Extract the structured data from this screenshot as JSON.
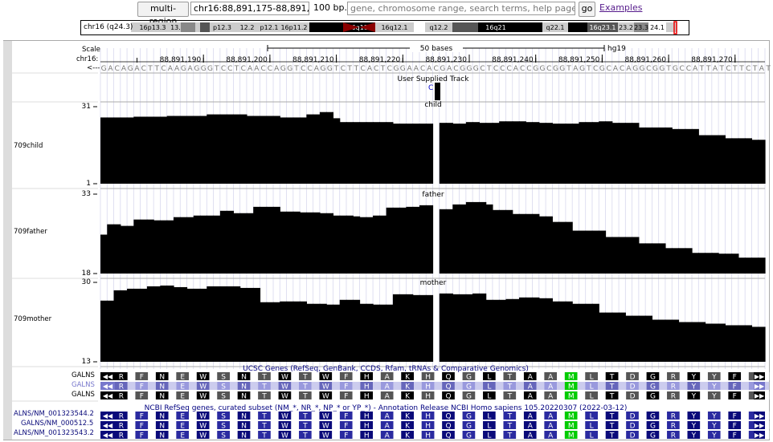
{
  "toolbar": {
    "multi_region": "multi-region",
    "position": "chr16:88,891,175-88,891,274",
    "size": "100 bp.",
    "search_placeholder": "gene, chromosome range, search terms, help pages, see examples",
    "go": "go",
    "examples": "Examples"
  },
  "ideogram": {
    "label": "chr16 (q24.3)",
    "bands": [
      "16p13.3",
      "13.2",
      "p12.3",
      "12.2",
      "p12.1",
      "16p11.2",
      "16q11.2",
      "16q12.1",
      "q12.2",
      "16q21",
      "q22.1",
      "16q23.1",
      "23.2",
      "23.3",
      "24.1"
    ]
  },
  "ruler": {
    "scale": "Scale",
    "chrom": "chr16:",
    "strand": "<---",
    "bases_label": "50 bases",
    "assembly": "hg19",
    "positions": [
      "88,891,190",
      "88,891,200",
      "88,891,210",
      "88,891,220",
      "88,891,230",
      "88,891,240",
      "88,891,250",
      "88,891,260",
      "88,891,270"
    ],
    "sequence": "GACAGACTTCAAGAGGGTCCTCAACCAGGTCCAGGTCTTCACTCGGAACACGACGGGCTCCCACCGGCGGTAGTCGCACAGGCGGTGCCATTATCTTCTAT"
  },
  "user_track": {
    "title": "User Supplied Track",
    "item": "C"
  },
  "wiggle_tracks": [
    {
      "name": "709child",
      "title": "child",
      "max": "31",
      "min": "1"
    },
    {
      "name": "709father",
      "title": "father",
      "max": "33",
      "min": "18"
    },
    {
      "name": "709mother",
      "title": "mother",
      "max": "30",
      "min": "13"
    }
  ],
  "ucsc_genes": {
    "title": "UCSC Genes (RefSeq, GenBank, CCDS, Rfam, tRNAs & Comparative Genomics)",
    "rows": [
      "GALNS",
      "GALNS",
      "GALNS"
    ]
  },
  "refseq": {
    "title": "NCBI RefSeq genes, curated subset (NM_*, NR_*, NP_* or YP_*) - Annotation Release NCBI Homo sapiens 105.20220307 (2022-03-12)",
    "rows": [
      "ALNS/NM_001323544.2",
      "GALNS/NM_000512.5",
      "ALNS/NM_001323543.2"
    ]
  },
  "amino_acids": [
    "R",
    "F",
    "N",
    "E",
    "W",
    "S",
    "N",
    "T",
    "W",
    "T",
    "W",
    "F",
    "H",
    "A",
    "K",
    "H",
    "Q",
    "G",
    "L",
    "T",
    "A",
    "A",
    "M",
    "L",
    "T",
    "D",
    "G",
    "R",
    "Y",
    "Y",
    "F",
    "I"
  ],
  "colors": {
    "codon_a": "#000000",
    "codon_b": "#555555",
    "start": "#00cc00",
    "gray_row": "#7777cc",
    "refseq": "#0a0a7a",
    "link": "#551a8b"
  }
}
